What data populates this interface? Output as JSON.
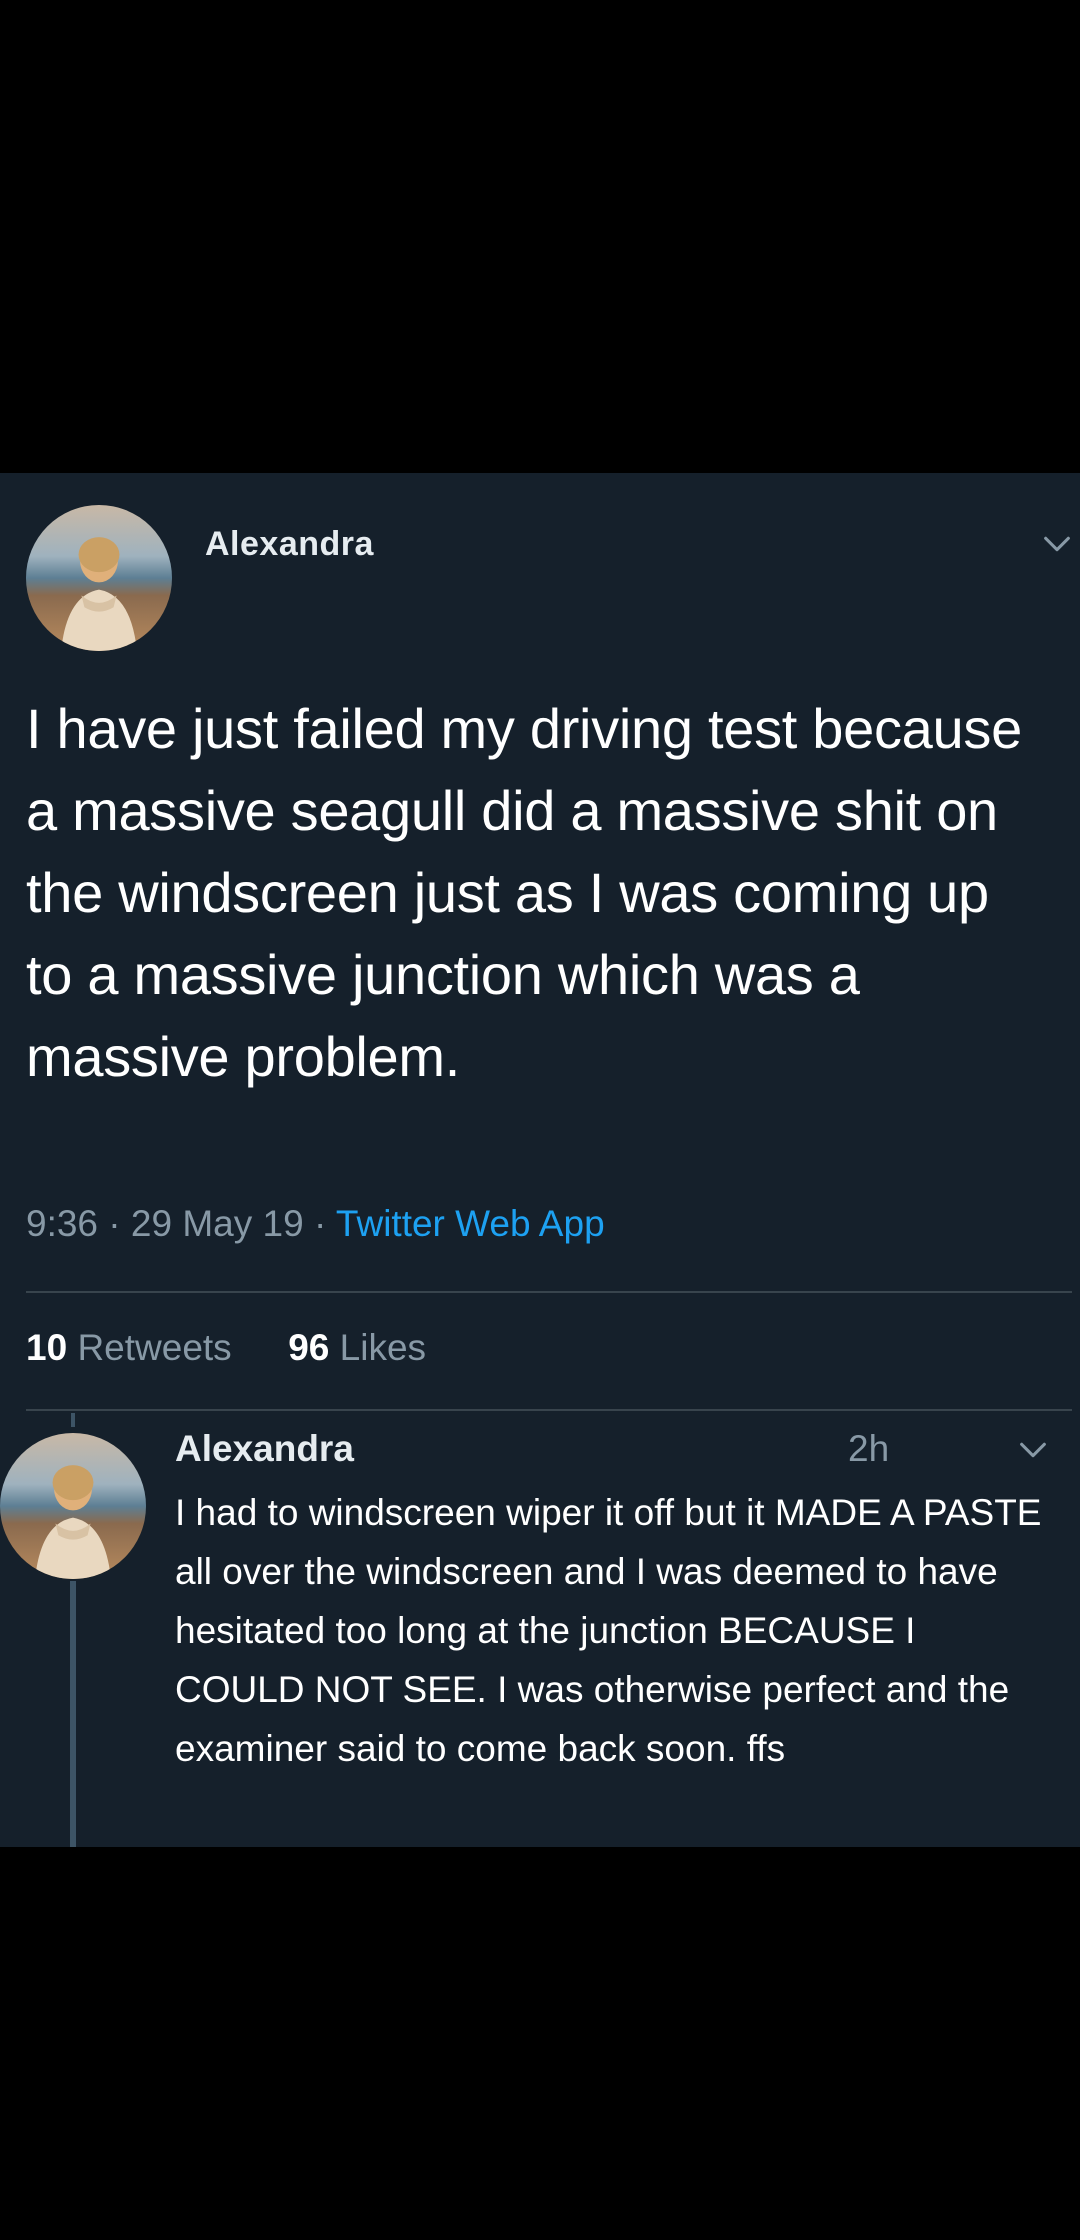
{
  "tweet": {
    "author": "Alexandra",
    "text": "I have just failed my driving test because a massive seagull did a massive shit on the windscreen just as I was coming up to a massive junction which was a massive problem.",
    "time": "9:36",
    "date": "29 May 19",
    "separator": "·",
    "source": "Twitter Web App",
    "retweets_count": "10",
    "retweets_label": "Retweets",
    "likes_count": "96",
    "likes_label": "Likes"
  },
  "reply": {
    "author": "Alexandra",
    "time": "2h",
    "text": "I had to windscreen wiper it off but it MADE A PASTE all over the windscreen and I was deemed to have hesitated too long at the junction BECAUSE I COULD NOT SEE. I was otherwise perfect and the examiner said to come back soon. ffs"
  },
  "icons": {
    "menu": "chevron-down-icon",
    "avatar": "avatar-photo"
  },
  "colors": {
    "background": "#15202b",
    "text": "#ffffff",
    "secondary": "#8899a6",
    "link": "#1da1f2",
    "divider": "#38444d"
  }
}
